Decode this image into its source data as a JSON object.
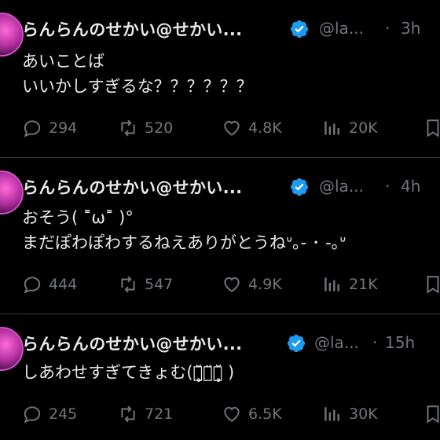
{
  "tweets": [
    {
      "name": "らんらんのせかい@せかい...",
      "handle": "@la...",
      "dot": "·",
      "time": "3h",
      "lines": [
        "あいことば",
        "いいかしすぎるな？？？？？？"
      ],
      "replies": "294",
      "reposts": "520",
      "likes": "4.8K",
      "views": "20K"
    },
    {
      "name": "らんらんのせかい@せかい...",
      "handle": "@la...",
      "dot": "·",
      "time": "4h",
      "lines": [
        "おそう( ˭ω˭ )°",
        "まだぽわぽわするねえありがとうねᐡ｡- ･ -｡ᐡ"
      ],
      "replies": "444",
      "reposts": "547",
      "likes": "4.9K",
      "views": "21K"
    },
    {
      "name": "らんらんのせかい@せかい...",
      "handle": "@la...",
      "dot": "·",
      "time": "15h",
      "lines": [
        "しあわせすぎてきょむ(꒪̥̆⌓̈꒪̥̆ )"
      ],
      "replies": "245",
      "reposts": "721",
      "likes": "6.5K",
      "views": "30K"
    }
  ],
  "icons": {
    "verified": "verified-badge-icon",
    "grok": "grok-icon",
    "reply": "reply-icon",
    "repost": "repost-icon",
    "like": "like-icon",
    "views": "views-icon",
    "bookmark": "bookmark-icon"
  },
  "colors": {
    "background": "#000000",
    "text": "#e7e9ea",
    "muted": "#71767b",
    "verified": "#1d9bf0",
    "divider": "#2f3336"
  }
}
